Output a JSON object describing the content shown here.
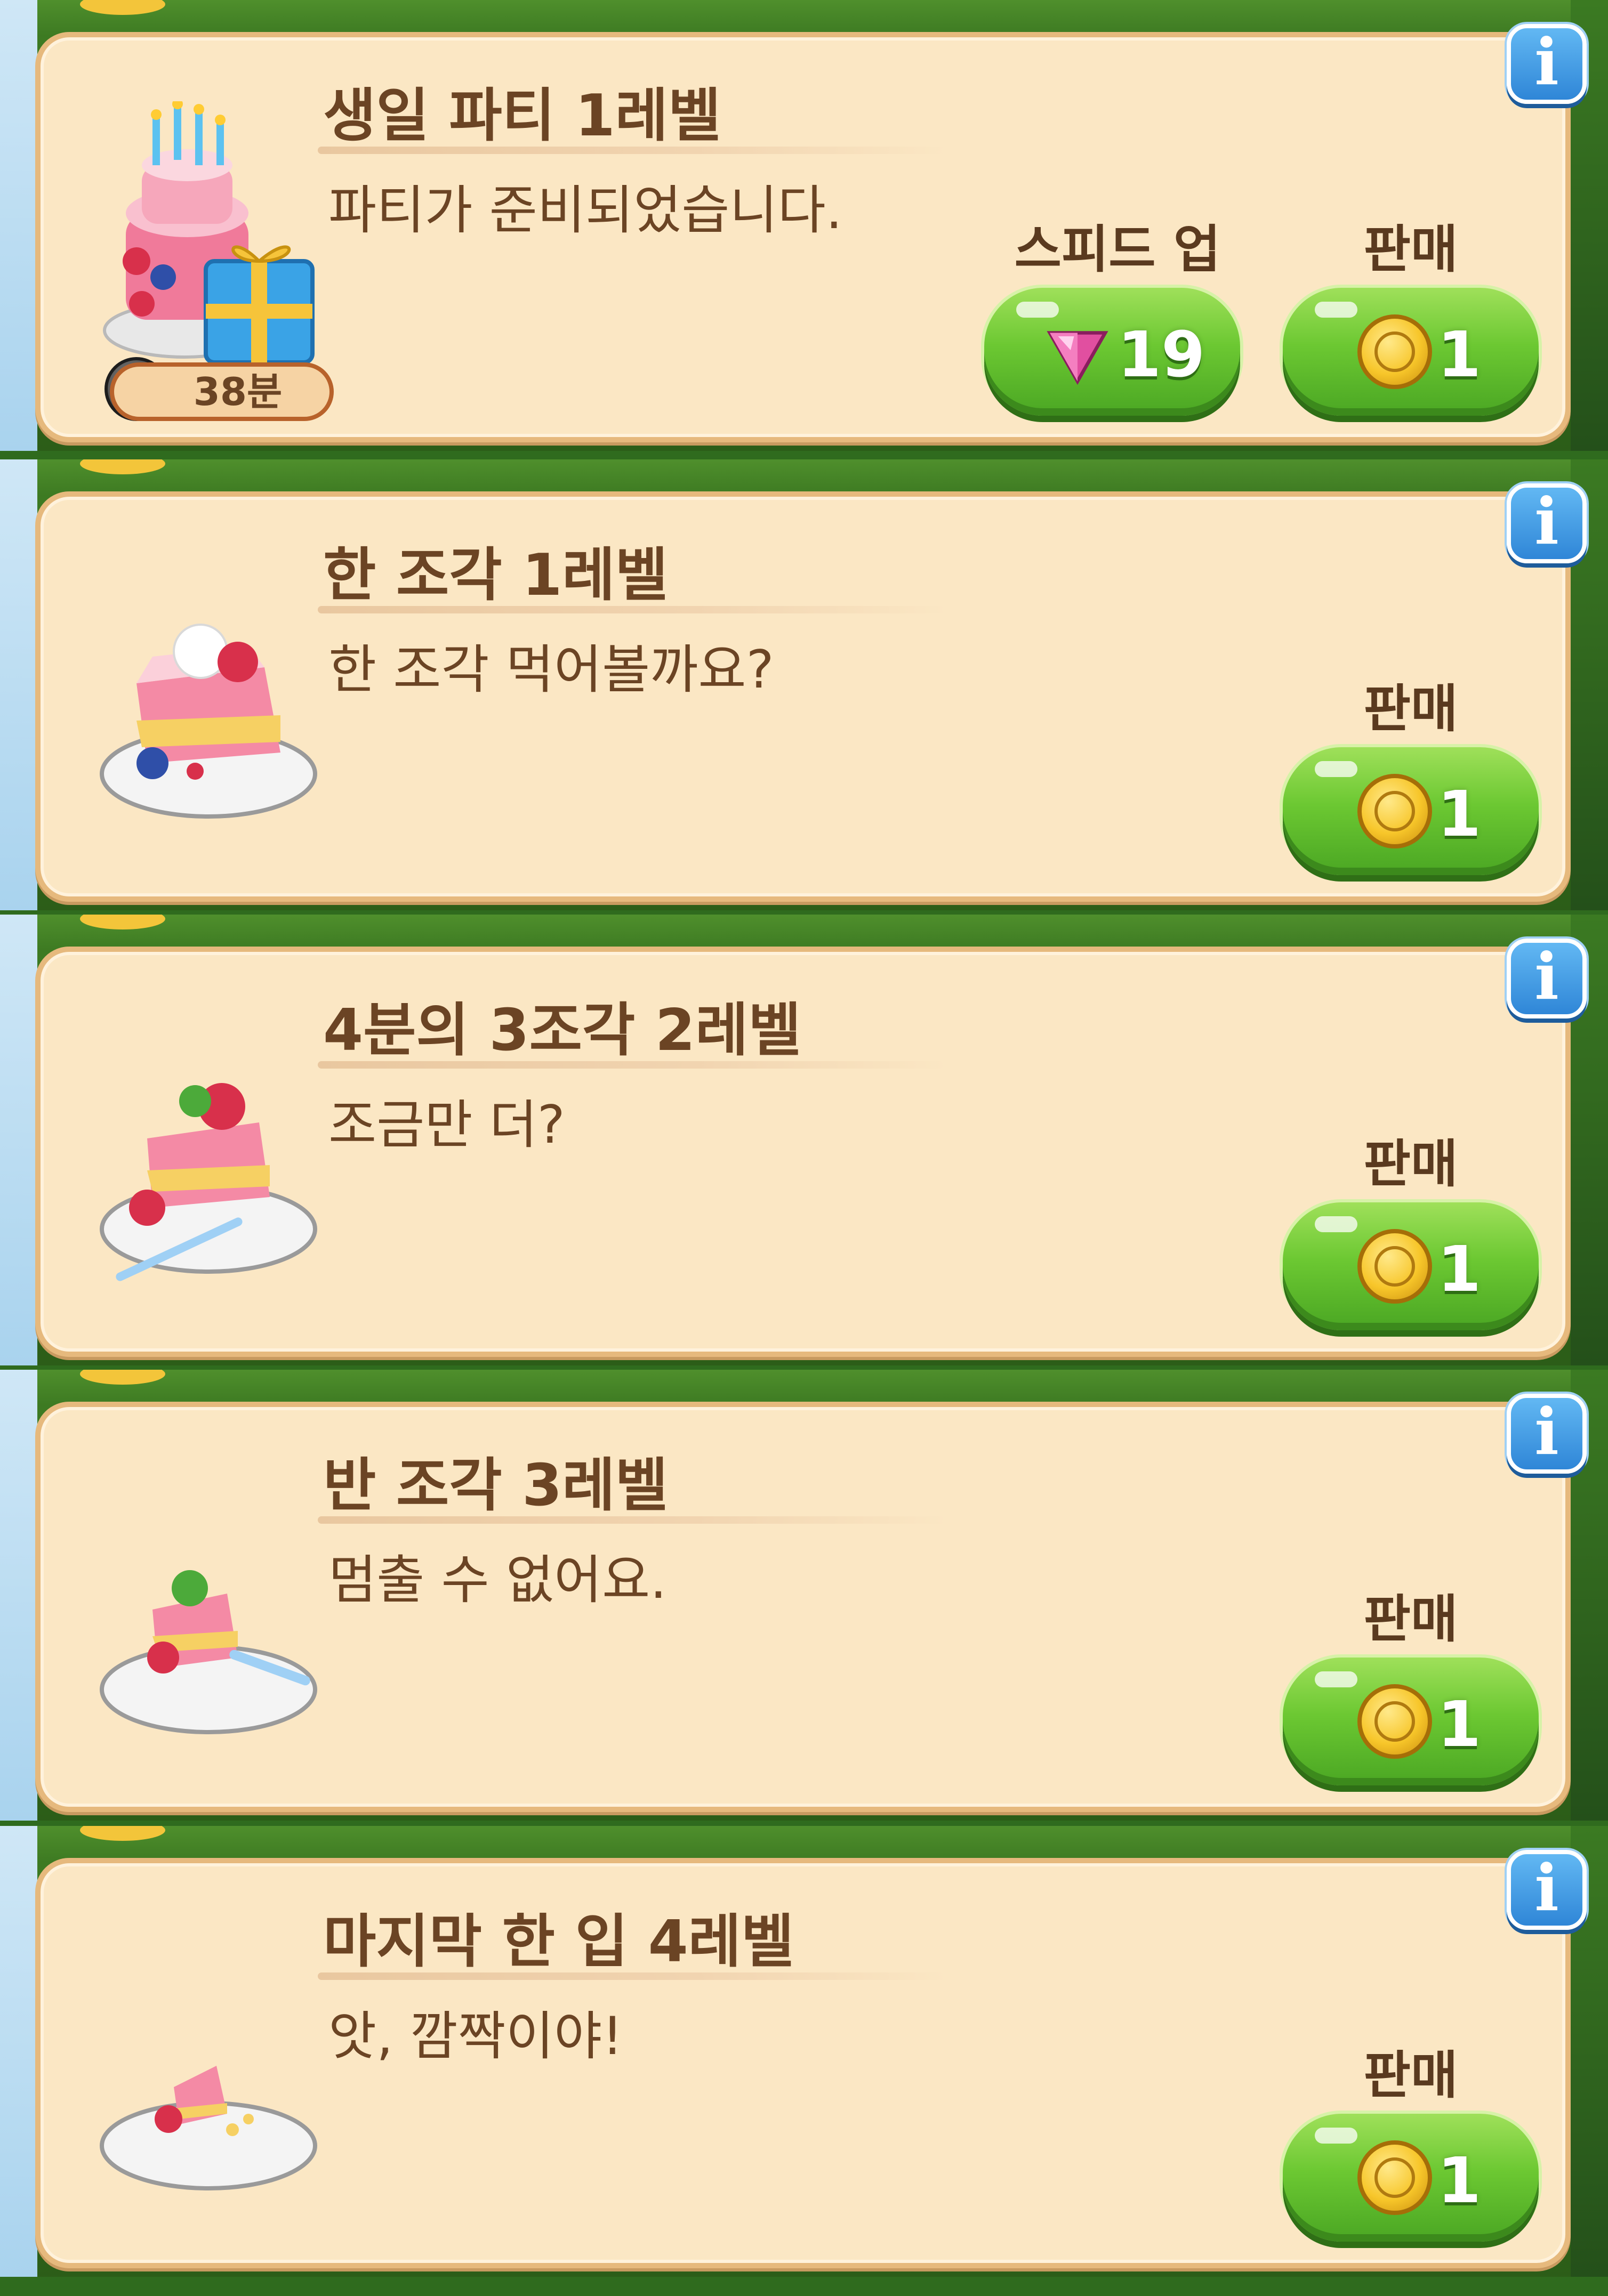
{
  "colors": {
    "card_bg": "#fbe7c4",
    "card_border": "#e6b97d",
    "text_brown": "#6b4424",
    "button_green": "#6cc832",
    "info_blue": "#2f86d7"
  },
  "items": [
    {
      "title": "생일 파티 1레벨",
      "description": "파티가 준비되었습니다.",
      "timer": "38분",
      "speed_up_label": "스피드 업",
      "speed_up_cost": "19",
      "sell_label": "판매",
      "sell_price": "1",
      "icon": "birthday-cake-gift-icon"
    },
    {
      "title": "한 조각 1레벨",
      "description": "한 조각 먹어볼까요?",
      "sell_label": "판매",
      "sell_price": "1",
      "icon": "cake-slice-icon"
    },
    {
      "title": "4분의 3조각 2레벨",
      "description": "조금만 더?",
      "sell_label": "판매",
      "sell_price": "1",
      "icon": "three-quarter-cake-icon"
    },
    {
      "title": "반 조각 3레벨",
      "description": "멈출 수 없어요.",
      "sell_label": "판매",
      "sell_price": "1",
      "icon": "half-cake-slice-icon"
    },
    {
      "title": "마지막 한 입 4레벨",
      "description": "앗, 깜짝이야!",
      "sell_label": "판매",
      "sell_price": "1",
      "icon": "last-bite-cake-icon"
    }
  ],
  "info_icon": "i"
}
